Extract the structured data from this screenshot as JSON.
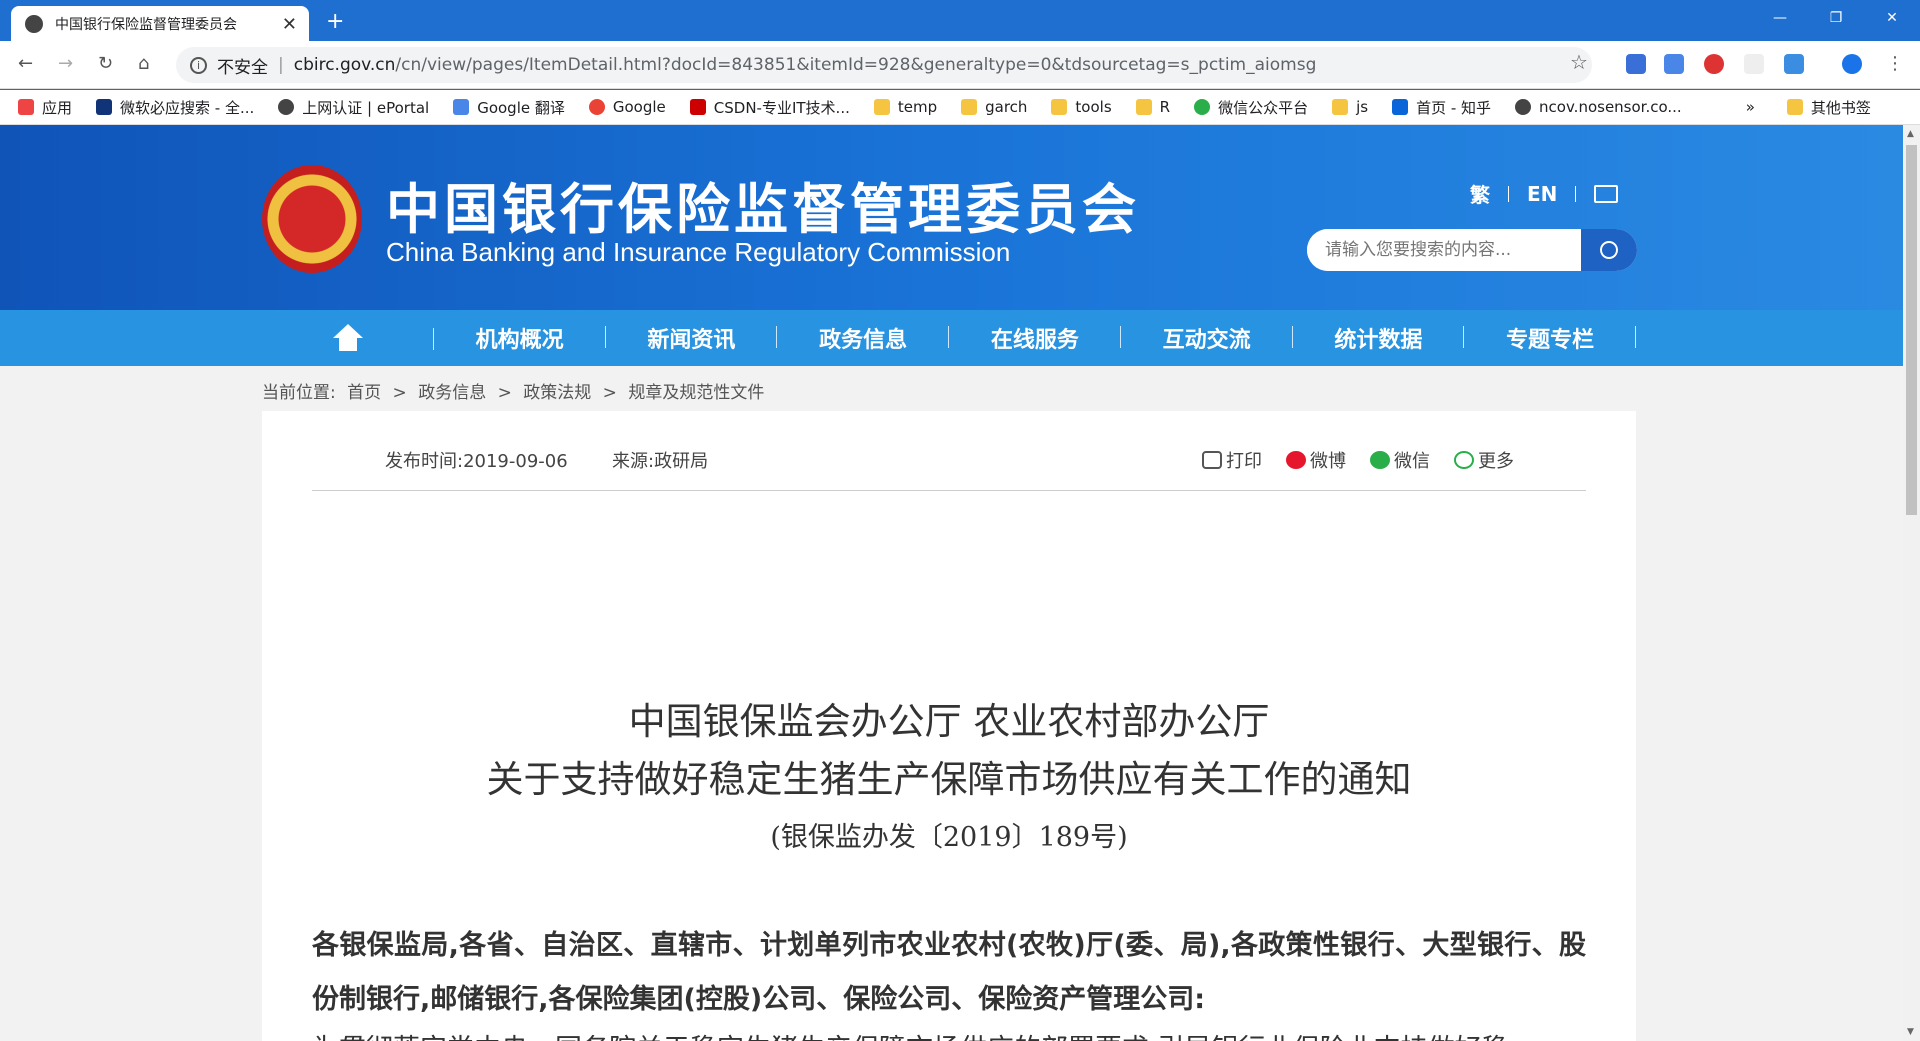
{
  "browser": {
    "tab_title": "中国银行保险监督管理委员会",
    "not_secure": "不安全",
    "url_host": "cbirc.gov.cn",
    "url_path": "/cn/view/pages/ItemDetail.html?docId=843851&itemId=928&generaltype=0&tdsourcetag=s_pctim_aiomsg",
    "bookmarks": [
      "应用",
      "微软必应搜索 - 全...",
      "上网认证 | ePortal",
      "Google 翻译",
      "Google",
      "CSDN-专业IT技术...",
      "temp",
      "garch",
      "tools",
      "R",
      "微信公众平台",
      "js",
      "首页 - 知乎",
      "ncov.nosensor.co...",
      "»",
      "其他书签"
    ]
  },
  "site": {
    "name_cn": "中国银行保险监督管理委员会",
    "name_en": "China Banking and Insurance Regulatory Commission",
    "lang_trad": "繁",
    "lang_en": "EN",
    "search_placeholder": "请输入您要搜索的内容..."
  },
  "nav": [
    "机构概况",
    "新闻资讯",
    "政务信息",
    "在线服务",
    "互动交流",
    "统计数据",
    "专题专栏"
  ],
  "breadcrumb": {
    "label": "当前位置:",
    "items": [
      "首页",
      ">",
      "政务信息",
      ">",
      "政策法规",
      ">",
      "规章及规范性文件"
    ]
  },
  "article": {
    "date": "发布时间:2019-09-06",
    "source": "来源:政研局",
    "print": "打印",
    "weibo": "微博",
    "wechat": "微信",
    "more": "更多",
    "title1": "中国银保监会办公厅 农业农村部办公厅",
    "title2": "关于支持做好稳定生猪生产保障市场供应有关工作的通知",
    "docno": "(银保监办发〔2019〕189号)",
    "addressee": "各银保监局,各省、自治区、直辖市、计划单列市农业农村(农牧)厅(委、局),各政策性银行、大型银行、股份制银行,邮储银行,各保险集团(控股)公司、保险公司、保险资产管理公司:",
    "body_start": "为贯彻落实党中央、国务院关于稳定生猪生产保障市场供应的部署要求,引导银行业保险业支持做好稳"
  }
}
